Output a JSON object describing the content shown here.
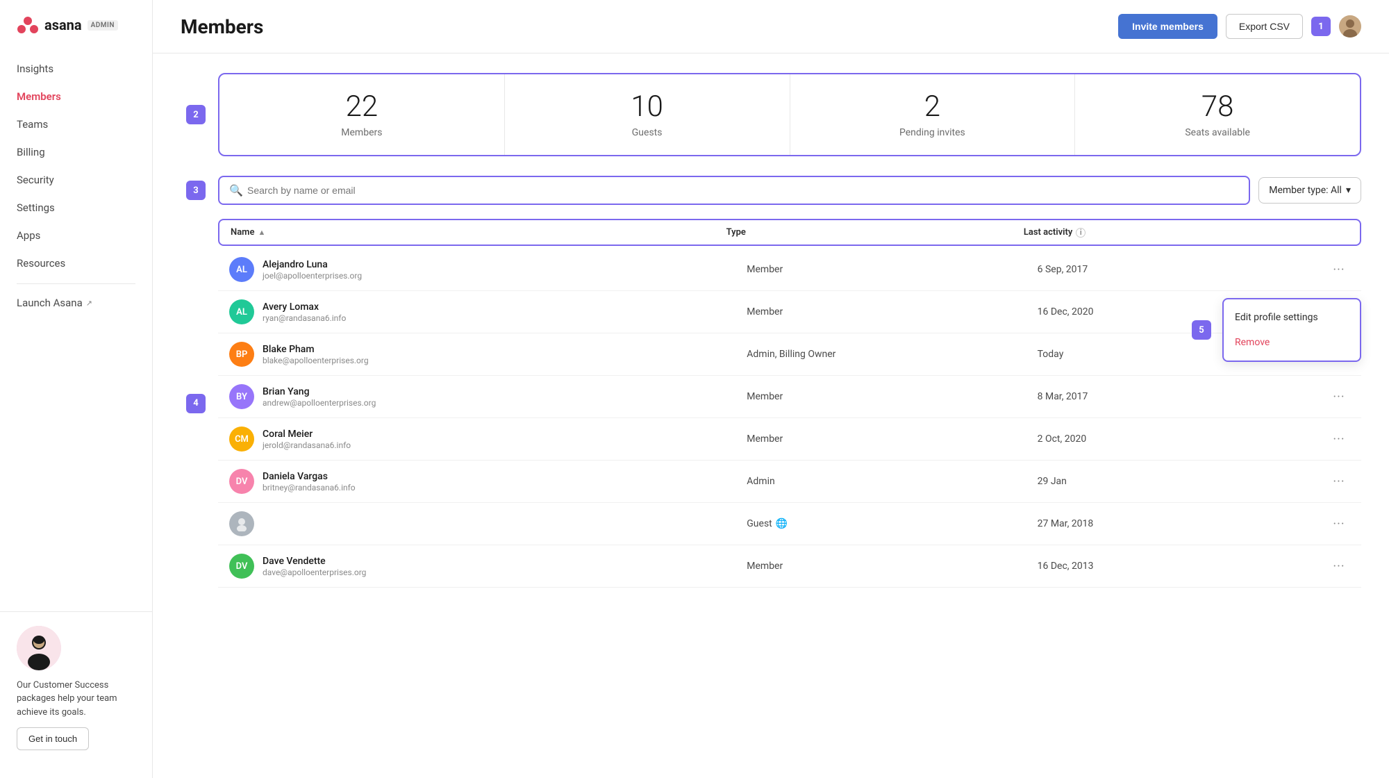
{
  "sidebar": {
    "logo_text": "asana",
    "admin_label": "ADMIN",
    "nav_items": [
      {
        "id": "insights",
        "label": "Insights",
        "active": false
      },
      {
        "id": "members",
        "label": "Members",
        "active": true
      },
      {
        "id": "teams",
        "label": "Teams",
        "active": false
      },
      {
        "id": "billing",
        "label": "Billing",
        "active": false
      },
      {
        "id": "security",
        "label": "Security",
        "active": false
      },
      {
        "id": "settings",
        "label": "Settings",
        "active": false
      },
      {
        "id": "apps",
        "label": "Apps",
        "active": false
      },
      {
        "id": "resources",
        "label": "Resources",
        "active": false
      }
    ],
    "launch_asana": "Launch Asana",
    "promo_text": "Our Customer Success packages help your team achieve its goals.",
    "get_in_touch": "Get in touch"
  },
  "header": {
    "title": "Members",
    "invite_btn": "Invite members",
    "export_btn": "Export CSV",
    "user_count": "1"
  },
  "stats": [
    {
      "number": "22",
      "label": "Members"
    },
    {
      "number": "10",
      "label": "Guests"
    },
    {
      "number": "2",
      "label": "Pending invites"
    },
    {
      "number": "78",
      "label": "Seats available"
    }
  ],
  "search": {
    "placeholder": "Search by name or email",
    "filter_label": "Member type: All"
  },
  "table": {
    "col_name": "Name",
    "col_type": "Type",
    "col_activity": "Last activity"
  },
  "members": [
    {
      "name": "Alejandro Luna",
      "email": "joel@apolloenterprises.org",
      "type": "Member",
      "activity": "6 Sep, 2017",
      "color": "av-blue",
      "initials": "AL"
    },
    {
      "name": "Avery Lomax",
      "email": "ryan@randasana6.info",
      "type": "Member",
      "activity": "16 Dec, 2020",
      "color": "av-teal",
      "initials": "AL"
    },
    {
      "name": "Blake Pham",
      "email": "blake@apolloenterprises.org",
      "type": "Admin, Billing Owner",
      "activity": "Today",
      "color": "av-orange",
      "initials": "BP"
    },
    {
      "name": "Brian Yang",
      "email": "andrew@apolloenterprises.org",
      "type": "Member",
      "activity": "8 Mar, 2017",
      "color": "av-purple",
      "initials": "BY"
    },
    {
      "name": "Coral Meier",
      "email": "jerold@randasana6.info",
      "type": "Member",
      "activity": "2 Oct, 2020",
      "color": "av-yellow",
      "initials": "CM"
    },
    {
      "name": "Daniela Vargas",
      "email": "britney@randasana6.info",
      "type": "Admin",
      "activity": "29 Jan",
      "color": "av-pink",
      "initials": "DV"
    },
    {
      "name": "",
      "email": "",
      "type": "Guest",
      "activity": "27 Mar, 2018",
      "color": "av-gray",
      "initials": "",
      "globe": true
    },
    {
      "name": "Dave Vendette",
      "email": "dave@apolloenterprises.org",
      "type": "Member",
      "activity": "16 Dec, 2013",
      "color": "av-green",
      "initials": "DV2"
    }
  ],
  "context_menu": {
    "edit": "Edit profile settings",
    "remove": "Remove"
  },
  "step_badges": [
    "2",
    "3",
    "4",
    "5"
  ]
}
